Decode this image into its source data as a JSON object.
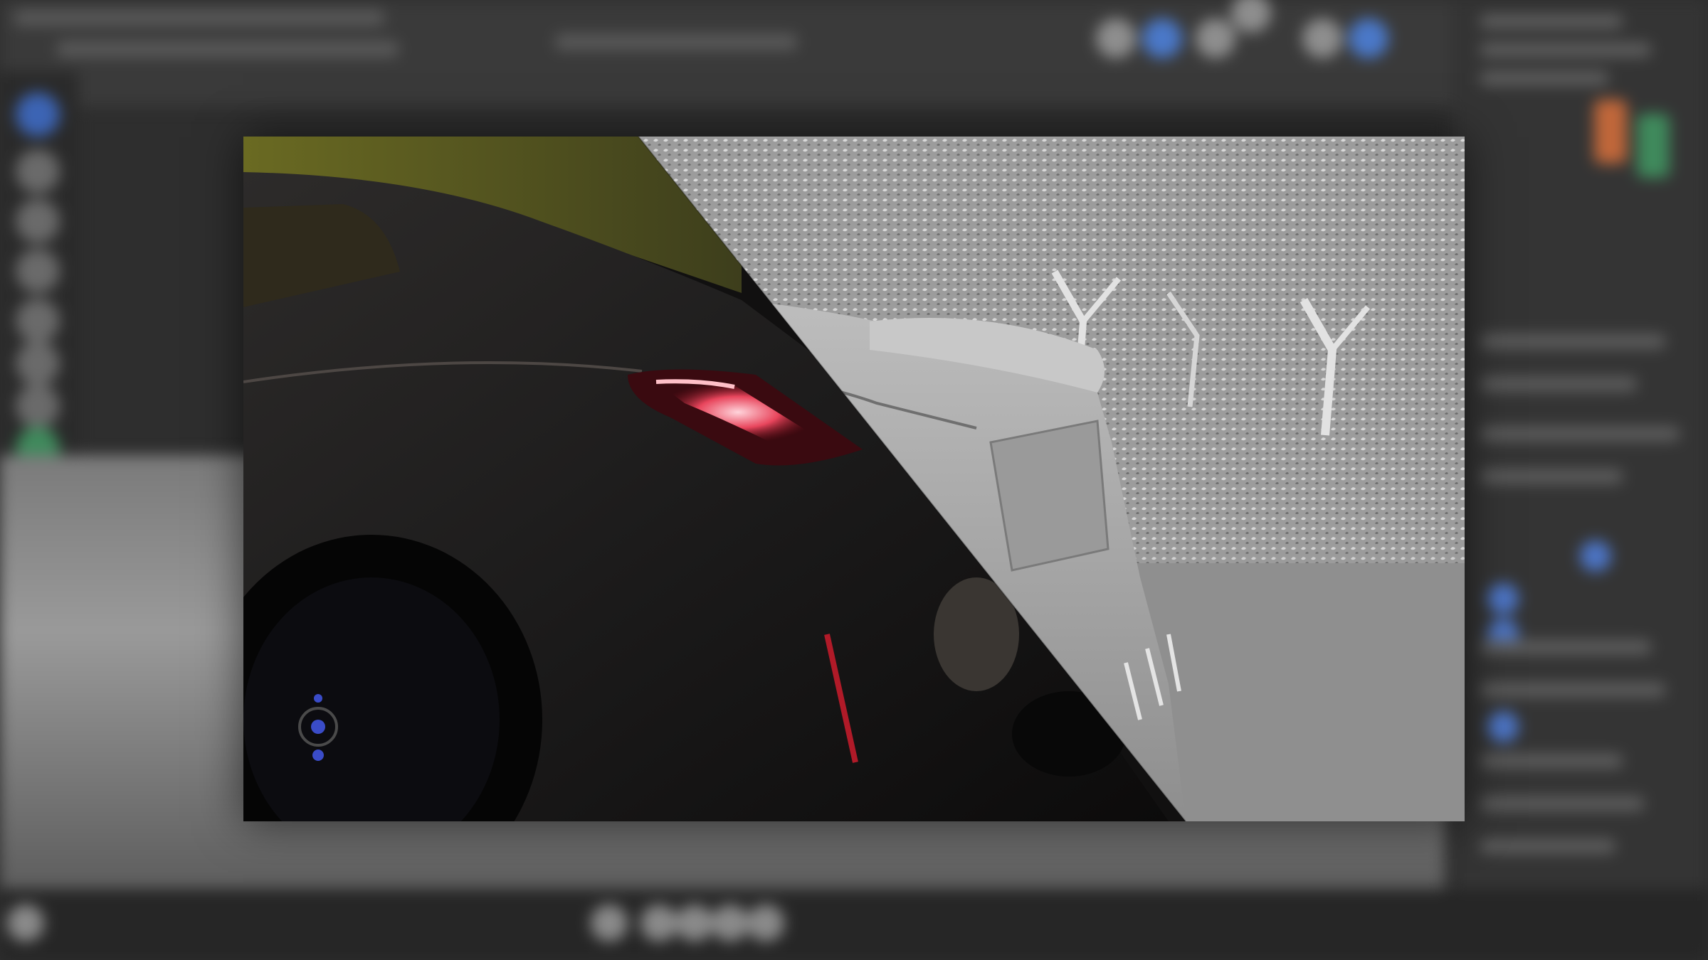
{
  "window": {
    "title": "",
    "background_state": "blurred"
  },
  "background_editor": {
    "toolbar_icons": [
      "render-icon",
      "viewport-shading-icon",
      "material-preview-icon",
      "rendered-view-icon",
      "overlay-icon"
    ],
    "left_toolbar_icons": [
      "select-icon",
      "cursor-icon",
      "move-icon",
      "rotate-icon",
      "scale-icon",
      "transform-icon",
      "annotate-icon",
      "measure-icon",
      "add-object-icon"
    ],
    "properties_icons": [
      "tool-icon",
      "render-props-icon",
      "output-props-icon",
      "scene-props-icon",
      "world-props-icon",
      "object-props-icon",
      "modifier-icon",
      "material-icon"
    ],
    "timeline_icons": [
      "play-icon",
      "jump-start-icon",
      "step-back-icon",
      "step-forward-icon",
      "jump-end-icon"
    ]
  },
  "render_comparison": {
    "left_pane": "final-render",
    "right_pane": "clay-wireframe",
    "split": "diagonal",
    "colors": {
      "car_body": "#1c1b1b",
      "tail_light": "#e8455c",
      "clay": "#a9a9a9",
      "foliage_bg": "#6a6a22",
      "ground_clay": "#8f8f8f"
    }
  }
}
